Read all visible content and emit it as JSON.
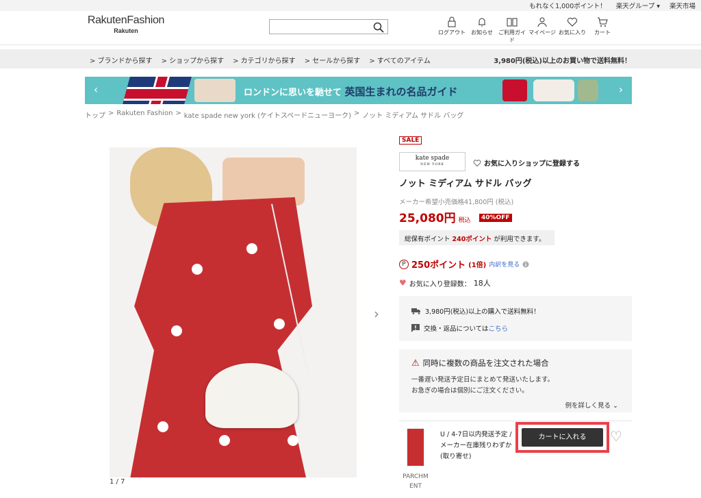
{
  "topbar": {
    "promo": "もれなく1,000ポイント！",
    "group": "楽天グループ ▾",
    "market": "楽天市場"
  },
  "header": {
    "logo_main": "RakutenFashion",
    "logo_sub": "Rakuten",
    "search_placeholder": "",
    "nav": [
      {
        "label": "ログアウト",
        "icon": "lock-icon"
      },
      {
        "label": "お知らせ",
        "icon": "bell-icon"
      },
      {
        "label": "ご利用ガイド",
        "icon": "book-icon"
      },
      {
        "label": "マイページ",
        "icon": "person-icon"
      },
      {
        "label": "お気に入り",
        "icon": "heart-icon"
      },
      {
        "label": "カート",
        "icon": "cart-icon"
      }
    ]
  },
  "catbar": {
    "items": [
      "> ブランドから探す",
      "> ショップから探す",
      "> カテゴリから探す",
      "> セールから探す",
      "> すべてのアイテム"
    ],
    "shipping": "3,980円(税込)以上のお買い物で送料無料！"
  },
  "banner": {
    "text_small": "ロンドンに思いを馳せて",
    "text_big": "英国生まれの名品ガイド"
  },
  "breadcrumb": [
    "トップ",
    ">",
    "Rakuten Fashion",
    ">",
    "kate spade new york (ケイトスペードニューヨーク)",
    ">",
    "ノット ミディアム サドル バッグ"
  ],
  "gallery": {
    "counter": "1 / 7"
  },
  "product": {
    "sale_badge": "SALE",
    "brand_logo_main": "kate spade",
    "brand_logo_sub": "NEW YORK",
    "fav_shop": "お気に入りショップに登録する",
    "title": "ノット ミディアム サドル バッグ",
    "list_price": "メーカー希望小売価格41,800円 (税込)",
    "price": "25,080円",
    "tax_label": "税込",
    "discount": "40%OFF",
    "owned_points_prefix": "総保有ポイント",
    "owned_points_value": "240ポイント",
    "owned_points_suffix": "が利用できます。",
    "points_symbol": "P",
    "points": "250ポイント",
    "points_mult": "(1倍)",
    "points_detail": "内訳を見る",
    "fav_count_label": "お気に入り登録数：",
    "fav_count": "18人"
  },
  "shipping_box": {
    "free_ship": "3,980円(税込)以上の購入で送料無料！",
    "returns_prefix": "交換・返品については",
    "returns_link": "こちら"
  },
  "notice": {
    "title": "同時に複数の商品を注文された場合",
    "line1": "一番遅い発送予定日にまとめて発送いたします。",
    "line2": "お急ぎの場合は個別にご注文ください。",
    "more": "例を詳しく見る ⌄"
  },
  "sku": {
    "color_line1": "PARCHM",
    "color_line2": "ENT",
    "stock_line1": "U / 4-7日以内発送予定 /",
    "stock_line2": "メーカー在庫残りわずか",
    "stock_line3": "(取り寄せ)",
    "cart_button": "カートに入れる"
  },
  "colors": {
    "accent_red": "#bf0000",
    "link_blue": "#3b6ac8",
    "highlight": "#e8414c"
  }
}
